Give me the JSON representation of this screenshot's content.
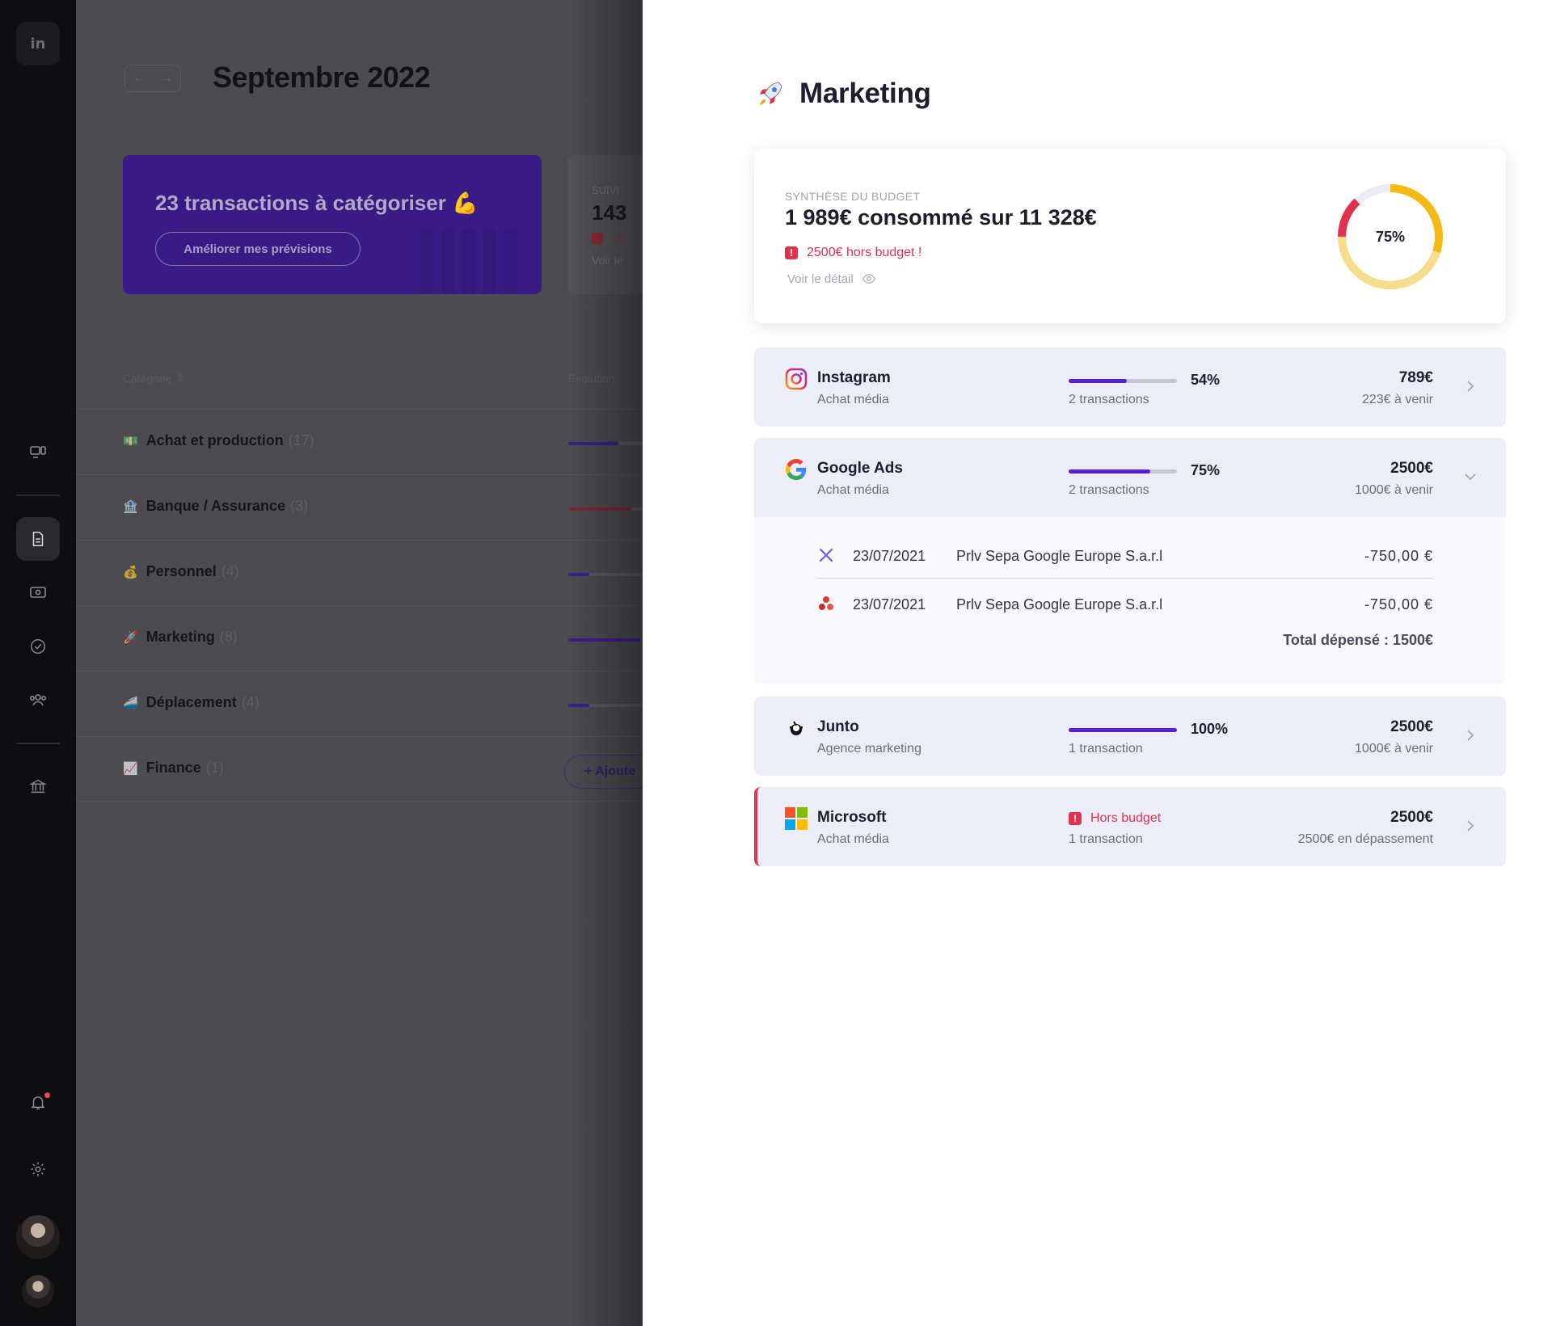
{
  "rail": {
    "logo": "in"
  },
  "background": {
    "month": "Septembre 2022",
    "nav_arrows": [
      "←",
      "→"
    ],
    "promo": {
      "title": "23 transactions à catégoriser 💪",
      "button": "Améliorer mes prévisions"
    },
    "suivi": {
      "label": "SUIVI",
      "value": "143",
      "alert": "33",
      "link": "Voir le"
    },
    "columns": {
      "category": "Catégorie ⇕",
      "evolution": "Evolution"
    },
    "rows": [
      {
        "emoji": "💵",
        "name": "Achat et production",
        "count": "(17)",
        "progress": 0.52,
        "color": "#3b1e8e"
      },
      {
        "emoji": "🏦",
        "name": "Banque / Assurance",
        "count": "(3)",
        "progress": 0.65,
        "color": "#7a2738"
      },
      {
        "emoji": "💰",
        "name": "Personnel",
        "count": "(4)",
        "progress": 0.22,
        "color": "#3b1e8e"
      },
      {
        "emoji": "🚀",
        "name": "Marketing",
        "count": "(8)",
        "progress": 0.75,
        "color": "#3b1e8e"
      },
      {
        "emoji": "🚄",
        "name": "Déplacement",
        "count": "(4)",
        "progress": 0.22,
        "color": "#3b1e8e"
      },
      {
        "emoji": "📈",
        "name": "Finance",
        "count": "(1)",
        "progress": 0,
        "color": "#3b1e8e"
      }
    ],
    "add_button": "+ Ajoute"
  },
  "panel": {
    "title": "Marketing",
    "summary": {
      "label": "SYNTHÈSE DU BUDGET",
      "main": "1 989€ consommé sur  11 328€",
      "warning": "2500€ hors budget !",
      "detail": "Voir le détail",
      "percent_label": "75%",
      "percent": 0.75,
      "over_fraction": 0.08,
      "colors": {
        "consumed": "#f5b914",
        "remaining": "#f7dc8c",
        "over": "#e0314f",
        "track": "#ececf4"
      }
    },
    "categories": [
      {
        "key": "instagram",
        "name": "Instagram",
        "sub": "Achat média",
        "progress": 0.54,
        "pct": "54%",
        "tx": "2 transactions",
        "amount": "789€",
        "rest": "223€ à venir"
      },
      {
        "key": "google",
        "name": "Google Ads",
        "sub": "Achat média",
        "progress": 0.75,
        "pct": "75%",
        "tx": "2 transactions",
        "amount": "2500€",
        "rest": "1000€ à venir",
        "transactions": [
          {
            "date": "23/07/2021",
            "label": "Prlv Sepa Google Europe S.a.r.l",
            "amount": "-750,00  €"
          },
          {
            "date": "23/07/2021",
            "label": "Prlv Sepa Google Europe S.a.r.l",
            "amount": "-750,00  €"
          }
        ],
        "total": "Total dépensé : 1500€"
      },
      {
        "key": "junto",
        "name": "Junto",
        "sub": "Agence marketing",
        "progress": 1.0,
        "pct": "100%",
        "tx": "1 transaction",
        "amount": "2500€",
        "rest": "1000€ à venir"
      },
      {
        "key": "microsoft",
        "name": "Microsoft",
        "sub": "Achat média",
        "badge": "Hors budget",
        "tx": "1 transaction",
        "amount": "2500€",
        "rest": "2500€ en dépassement"
      }
    ]
  }
}
